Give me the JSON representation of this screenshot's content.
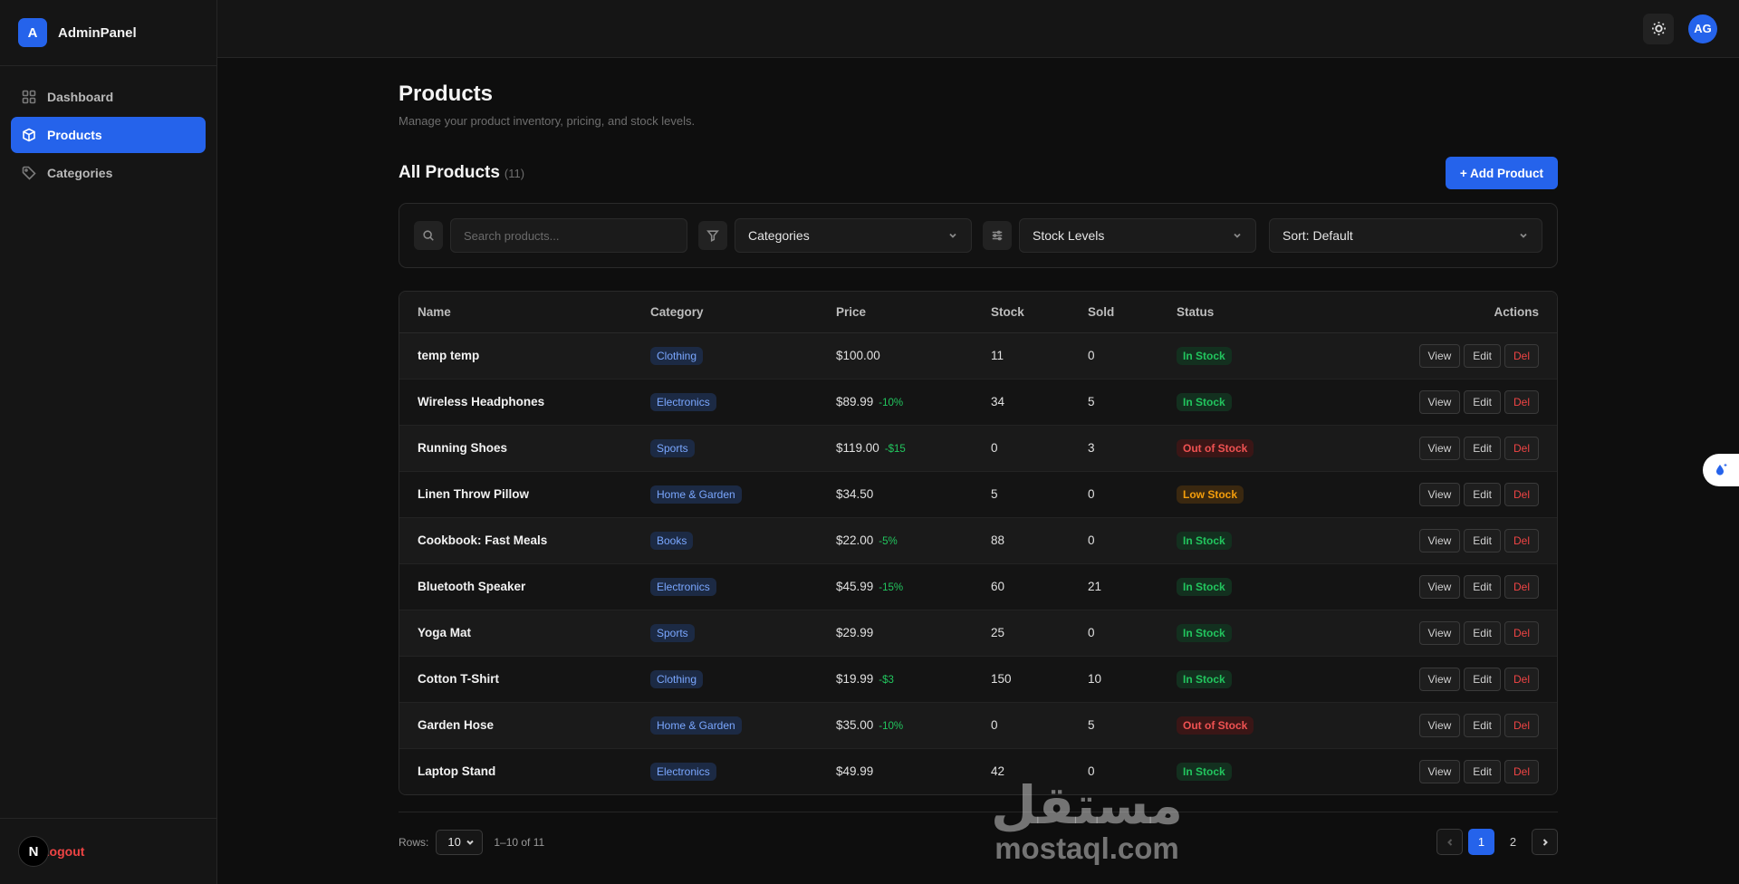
{
  "brand": {
    "logo_letter": "A",
    "name": "AdminPanel"
  },
  "nav": [
    {
      "label": "Dashboard",
      "icon": "grid-icon",
      "active": false
    },
    {
      "label": "Products",
      "icon": "box-icon",
      "active": true
    },
    {
      "label": "Categories",
      "icon": "tag-icon",
      "active": false
    }
  ],
  "footer": {
    "badge": "N",
    "logout_label": "Logout"
  },
  "topbar": {
    "avatar_initials": "AG",
    "theme_icon": "sun-icon"
  },
  "page": {
    "title": "Products",
    "subtitle": "Manage your product inventory, pricing, and stock levels."
  },
  "section": {
    "title": "All Products",
    "count": "(11)",
    "add_label": "+ Add Product"
  },
  "filters": {
    "search_placeholder": "Search products...",
    "categories_label": "Categories",
    "stock_label": "Stock Levels",
    "sort_label": "Sort: Default"
  },
  "table": {
    "columns": [
      "Name",
      "Category",
      "Price",
      "Stock",
      "Sold",
      "Status",
      "Actions"
    ],
    "action_labels": {
      "view": "View",
      "edit": "Edit",
      "del": "Del"
    },
    "rows": [
      {
        "name": "temp temp",
        "category": "Clothing",
        "price": "$100.00",
        "discount": "",
        "stock": "11",
        "sold": "0",
        "status": "In Stock",
        "status_type": "in"
      },
      {
        "name": "Wireless Headphones",
        "category": "Electronics",
        "price": "$89.99",
        "discount": "-10%",
        "stock": "34",
        "sold": "5",
        "status": "In Stock",
        "status_type": "in"
      },
      {
        "name": "Running Shoes",
        "category": "Sports",
        "price": "$119.00",
        "discount": "-$15",
        "stock": "0",
        "sold": "3",
        "status": "Out of Stock",
        "status_type": "out"
      },
      {
        "name": "Linen Throw Pillow",
        "category": "Home & Garden",
        "price": "$34.50",
        "discount": "",
        "stock": "5",
        "sold": "0",
        "status": "Low Stock",
        "status_type": "low"
      },
      {
        "name": "Cookbook: Fast Meals",
        "category": "Books",
        "price": "$22.00",
        "discount": "-5%",
        "stock": "88",
        "sold": "0",
        "status": "In Stock",
        "status_type": "in"
      },
      {
        "name": "Bluetooth Speaker",
        "category": "Electronics",
        "price": "$45.99",
        "discount": "-15%",
        "stock": "60",
        "sold": "21",
        "status": "In Stock",
        "status_type": "in"
      },
      {
        "name": "Yoga Mat",
        "category": "Sports",
        "price": "$29.99",
        "discount": "",
        "stock": "25",
        "sold": "0",
        "status": "In Stock",
        "status_type": "in"
      },
      {
        "name": "Cotton T-Shirt",
        "category": "Clothing",
        "price": "$19.99",
        "discount": "-$3",
        "stock": "150",
        "sold": "10",
        "status": "In Stock",
        "status_type": "in"
      },
      {
        "name": "Garden Hose",
        "category": "Home & Garden",
        "price": "$35.00",
        "discount": "-10%",
        "stock": "0",
        "sold": "5",
        "status": "Out of Stock",
        "status_type": "out"
      },
      {
        "name": "Laptop Stand",
        "category": "Electronics",
        "price": "$49.99",
        "discount": "",
        "stock": "42",
        "sold": "0",
        "status": "In Stock",
        "status_type": "in"
      }
    ]
  },
  "pagination": {
    "rows_label": "Rows:",
    "rows_value": "10",
    "range": "1–10 of 11",
    "pages": [
      "1",
      "2"
    ],
    "current_page": "1"
  },
  "watermark": {
    "arabic": "مستقل",
    "latin": "mostaql.com"
  },
  "colors": {
    "accent": "#2563eb",
    "in_stock": "#22c55e",
    "out_of_stock": "#f05252",
    "low_stock": "#f59e0b",
    "danger": "#ef4444"
  }
}
